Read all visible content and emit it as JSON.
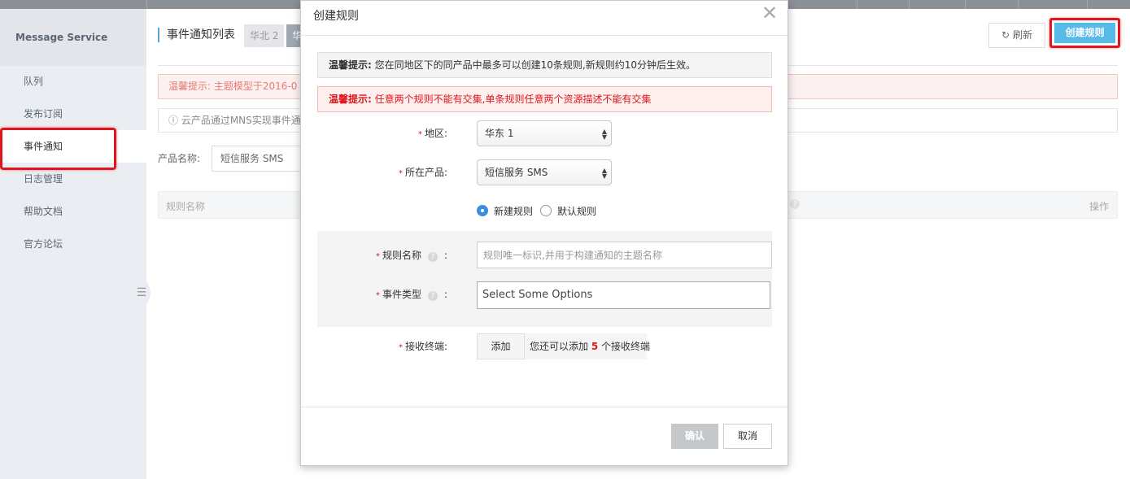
{
  "sidebar": {
    "title": "Message Service",
    "items": [
      {
        "label": "队列"
      },
      {
        "label": "发布订阅"
      },
      {
        "label": "事件通知",
        "active": true
      },
      {
        "label": "日志管理"
      },
      {
        "label": "帮助文档"
      },
      {
        "label": "官方论坛"
      }
    ],
    "toggle_icon": "☰"
  },
  "main": {
    "title": "事件通知列表",
    "region_tabs": [
      "华北 2",
      "华"
    ],
    "refresh_icon": "↻",
    "refresh_label": "刷新",
    "create_label": "创建规则",
    "warning_text": "温馨提示:   主题模型于2016-0",
    "info_text": "ⓘ 云产品通过MNS实现事件通",
    "product_label": "产品名称:",
    "product_value": "短信服务 SMS",
    "table": {
      "col_name": "规则名称",
      "col_action": "操作",
      "help_icon": "?"
    }
  },
  "modal": {
    "title": "创建规则",
    "close_icon": "✕",
    "tip1_bold": "温馨提示:",
    "tip1_text": "您在同地区下的同产品中最多可以创建10条规则,新规则约10分钟后生效。",
    "tip2_bold": "温馨提示:",
    "tip2_text": "任意两个规则不能有交集,单条规则任意两个资源描述不能有交集",
    "required_mark": "*",
    "region_label": "地区:",
    "region_value": "华东 1",
    "product_label": "所在产品:",
    "product_value": "短信服务 SMS",
    "select_arrow_up": "▲",
    "select_arrow_down": "▼",
    "radio_new": "新建规则",
    "radio_default": "默认规则",
    "radio_selected": "新建规则",
    "rule_name_label": "规则名称",
    "rule_name_placeholder": "规则唯一标识,并用于构建通知的主题名称",
    "event_type_label": "事件类型",
    "event_type_placeholder": "Select Some Options",
    "help_icon": "?",
    "colon": ":",
    "endpoint_label": "接收终端:",
    "add_label": "添加",
    "add_hint_prefix": "您还可以添加",
    "add_hint_count": "5",
    "add_hint_suffix": "个接收终端",
    "ok_label": "确认",
    "cancel_label": "取消"
  },
  "colors": {
    "accent": "#57bbe9",
    "highlight_red": "#e0151d",
    "radio_blue": "#3c8ddc"
  }
}
